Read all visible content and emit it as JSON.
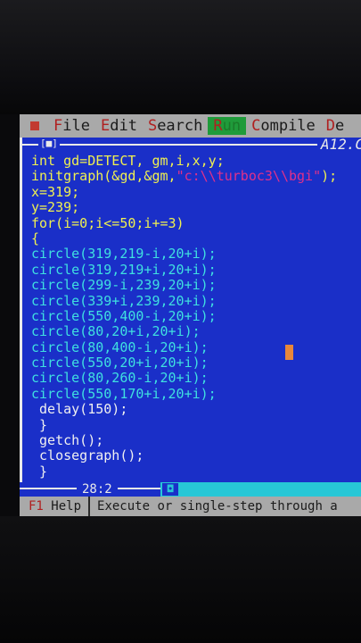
{
  "menu": {
    "items": [
      {
        "hot": "F",
        "rest": "ile"
      },
      {
        "hot": "E",
        "rest": "dit"
      },
      {
        "hot": "S",
        "rest": "earch"
      },
      {
        "hot": "R",
        "rest": "un"
      },
      {
        "hot": "C",
        "rest": "ompile"
      },
      {
        "hot": "D",
        "rest": "e"
      }
    ]
  },
  "editor": {
    "window_button": "[■]",
    "file_name": "A12.C",
    "lines": [
      {
        "parts": [
          {
            "t": "int gd=DETECT, gm,i,x,y;",
            "c": "kw"
          }
        ]
      },
      {
        "parts": [
          {
            "t": "initgraph(&gd,&gm,",
            "c": "kw"
          },
          {
            "t": "\"c:\\\\turboc3\\\\bgi\"",
            "c": "str"
          },
          {
            "t": ");",
            "c": "kw"
          }
        ]
      },
      {
        "parts": [
          {
            "t": "x=319;",
            "c": "kw"
          }
        ]
      },
      {
        "parts": [
          {
            "t": "y=239;",
            "c": "kw"
          }
        ]
      },
      {
        "parts": [
          {
            "t": "for(i=0;i<=50;i+=3)",
            "c": "kw"
          }
        ]
      },
      {
        "parts": [
          {
            "t": "{",
            "c": "kw"
          }
        ]
      },
      {
        "parts": [
          {
            "t": "circle(319,219-i,20+i);",
            "c": "fn"
          }
        ]
      },
      {
        "parts": [
          {
            "t": "circle(319,219+i,20+i);",
            "c": "fn"
          }
        ]
      },
      {
        "parts": [
          {
            "t": "circle(299-i,239,20+i);",
            "c": "fn"
          }
        ]
      },
      {
        "parts": [
          {
            "t": "circle(339+i,239,20+i);",
            "c": "fn"
          }
        ]
      },
      {
        "parts": [
          {
            "t": "circle(550,400-i,20+i);",
            "c": "fn"
          }
        ]
      },
      {
        "parts": [
          {
            "t": "circle(80,20+i,20+i);",
            "c": "fn"
          }
        ]
      },
      {
        "parts": [
          {
            "t": "circle(80,400-i,20+i);",
            "c": "fn"
          }
        ]
      },
      {
        "parts": [
          {
            "t": "circle(550,20+i,20+i);",
            "c": "fn"
          }
        ]
      },
      {
        "parts": [
          {
            "t": "circle(80,260-i,20+i);",
            "c": "fn"
          }
        ]
      },
      {
        "parts": [
          {
            "t": "circle(550,170+i,20+i);",
            "c": "fn"
          }
        ]
      },
      {
        "parts": [
          {
            "t": " delay(150);",
            "c": "tx"
          }
        ]
      },
      {
        "parts": [
          {
            "t": " }",
            "c": "tx"
          }
        ]
      },
      {
        "parts": [
          {
            "t": " getch();",
            "c": "tx"
          }
        ]
      },
      {
        "parts": [
          {
            "t": " closegraph();",
            "c": "tx"
          }
        ]
      },
      {
        "parts": [
          {
            "t": " }",
            "c": "tx"
          }
        ]
      }
    ]
  },
  "status": {
    "position": "28:2",
    "scroll_thumb": "◘"
  },
  "hint": {
    "f1_key": "F1",
    "f1_label": " Help",
    "message": "Execute or single-step through a"
  },
  "colors": {
    "editor_bg": "#1a2fc8",
    "menu_bg": "#a9a9a9",
    "hotkey": "#b02020",
    "active_menu": "#1f9b3a",
    "keyword_text": "#f0f050",
    "string_text": "#e0308a",
    "function_text": "#3fe0e0"
  },
  "icons": {
    "system_menu": "system-menu-icon",
    "window_close": "window-close-icon",
    "cursor": "text-cursor-icon"
  }
}
